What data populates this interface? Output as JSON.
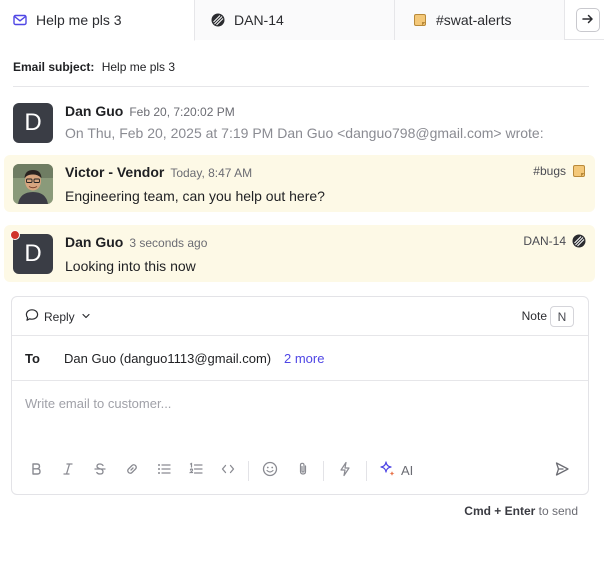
{
  "tabs": [
    {
      "label": "Help me pls 3",
      "icon": "mail-icon"
    },
    {
      "label": "DAN-14",
      "icon": "linear-icon"
    },
    {
      "label": "#swat-alerts",
      "icon": "note-icon"
    }
  ],
  "subject": {
    "label": "Email subject:",
    "value": "Help me pls 3"
  },
  "messages": [
    {
      "initial": "D",
      "sender": "Dan Guo",
      "time": "Feb 20, 7:20:02 PM",
      "body": "On Thu, Feb 20, 2025 at 7:19 PM Dan Guo <danguo798@gmail.com> wrote:",
      "tag": ""
    },
    {
      "initial": "",
      "sender": "Victor - Vendor",
      "time": "Today, 8:47 AM",
      "body": "Engineering team, can you help out here?",
      "tag": "#bugs"
    },
    {
      "initial": "D",
      "sender": "Dan Guo",
      "time": "3 seconds ago",
      "body": "Looking into this now",
      "tag": "DAN-14"
    }
  ],
  "composer": {
    "reply_label": "Reply",
    "note_label": "Note",
    "note_shortcut": "N",
    "to_label": "To",
    "to_value": "Dan Guo (danguo1113@gmail.com)",
    "to_more": "2 more",
    "placeholder": "Write email to customer...",
    "ai_label": "AI"
  },
  "hint": {
    "keys": "Cmd + Enter",
    "suffix": " to send"
  },
  "colors": {
    "highlight": "#fdf9e6",
    "link": "#4f46e5",
    "unread": "#d0342c",
    "avatar": "#3a3d45"
  }
}
